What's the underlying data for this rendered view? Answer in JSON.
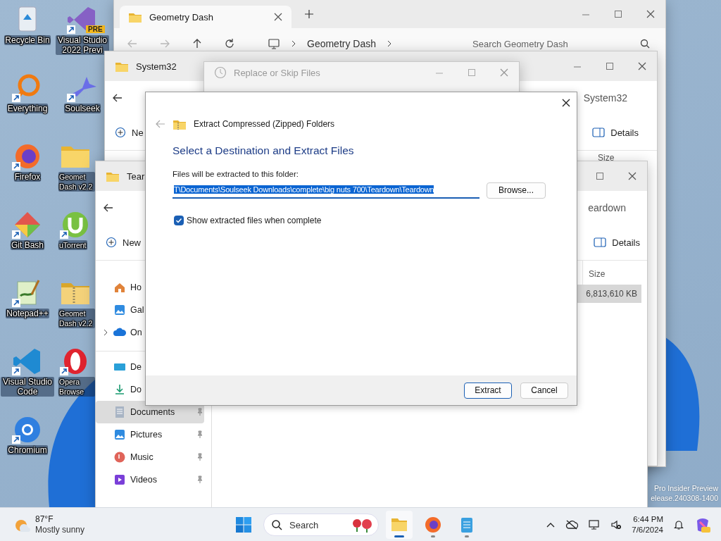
{
  "desktop_icons": [
    {
      "label": "Recycle Bin",
      "shortcut": false
    },
    {
      "label": "Everything",
      "shortcut": true
    },
    {
      "label": "Firefox",
      "shortcut": true
    },
    {
      "label": "Git Bash",
      "shortcut": true
    },
    {
      "label": "Notepad++",
      "shortcut": true
    },
    {
      "label": "Visual Studio Code",
      "shortcut": true
    },
    {
      "label": "Chromium",
      "shortcut": true
    },
    {
      "label": "Visual Studio 2022 Previ",
      "shortcut": true,
      "badge": "PRE"
    },
    {
      "label": "Soulseek",
      "shortcut": true
    },
    {
      "label": "Geomet Dash v2.2",
      "shortcut": false
    },
    {
      "label": "uTorrent",
      "shortcut": true
    },
    {
      "label": "Geomet Dash v2.2",
      "shortcut": false
    },
    {
      "label": "Opera Browse",
      "shortcut": true
    }
  ],
  "geometry_window": {
    "tab_title": "Geometry Dash",
    "breadcrumb": "Geometry Dash",
    "search_placeholder": "Search Geometry Dash"
  },
  "system32_window": {
    "title": "System32",
    "search_placeholder": "System32",
    "new_label": "Ne",
    "details_label": "Details",
    "size_header": "Size"
  },
  "replace_window": {
    "title": "Replace or Skip Files"
  },
  "teardown_window": {
    "title": "Tear",
    "search_placeholder": "eardown",
    "new_label": "New",
    "details_label": "Details",
    "sidebar": [
      {
        "items": [
          {
            "label": "Ho",
            "selected": false,
            "expandable": false
          },
          {
            "label": "Gal",
            "selected": false,
            "expandable": false
          },
          {
            "label": "On",
            "selected": false,
            "expandable": true
          }
        ]
      },
      {
        "items": [
          {
            "label": "De",
            "selected": false,
            "expandable": false
          },
          {
            "label": "Do",
            "selected": false,
            "expandable": false
          },
          {
            "label": "Documents",
            "selected": true,
            "expandable": false,
            "pinned": true
          },
          {
            "label": "Pictures",
            "selected": false,
            "expandable": false,
            "pinned": true
          },
          {
            "label": "Music",
            "selected": false,
            "expandable": false,
            "pinned": true
          },
          {
            "label": "Videos",
            "selected": false,
            "expandable": false,
            "pinned": true
          }
        ]
      }
    ],
    "size_header": "Size",
    "files": [
      {
        "size": "6,813,610 KB",
        "selected": true
      }
    ]
  },
  "extract_dialog": {
    "app_title": "Extract Compressed (Zipped) Folders",
    "heading": "Select a Destination and Extract Files",
    "field_label": "Files will be extracted to this folder:",
    "path": "T\\Documents\\Soulseek Downloads\\complete\\big nuts 700\\Teardown\\Teardown",
    "path_selected": true,
    "browse_label": "Browse...",
    "show_files_label": "Show extracted files when complete",
    "show_files_checked": true,
    "buttons": [
      {
        "label": "Extract",
        "default": true
      },
      {
        "label": "Cancel",
        "default": false
      }
    ]
  },
  "watermark_lines": [
    "Pro Insider Preview",
    "elease.240308-1400"
  ],
  "taskbar": {
    "temperature": "87°F",
    "condition": "Mostly sunny",
    "search_placeholder": "Search",
    "apps": [
      {
        "active": true
      },
      {
        "active": false
      },
      {
        "active": false
      }
    ],
    "time": "6:44 PM",
    "date": "7/6/2024"
  }
}
